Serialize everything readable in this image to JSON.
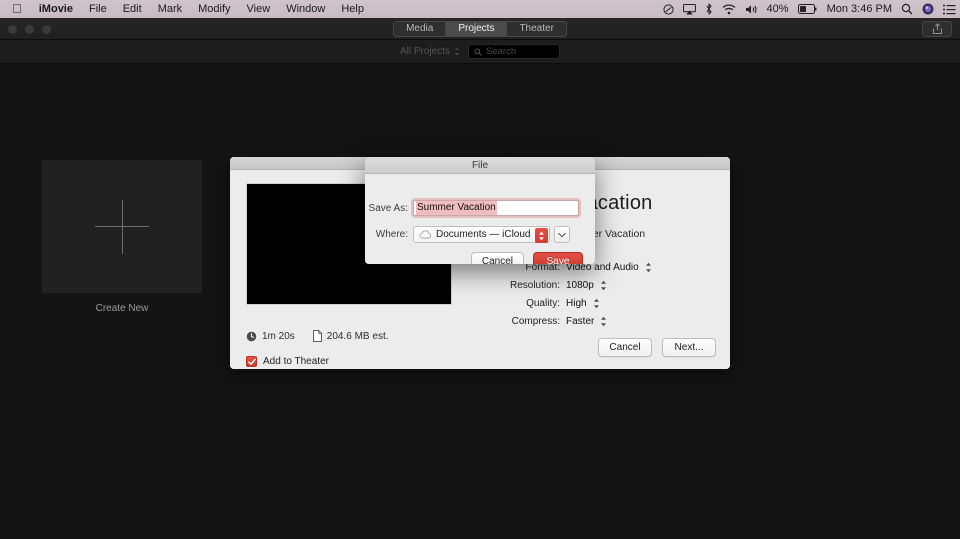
{
  "menubar": {
    "apple_icon": "apple-logo",
    "items": [
      {
        "label": "iMovie",
        "bold": true
      },
      {
        "label": "File"
      },
      {
        "label": "Edit"
      },
      {
        "label": "Mark"
      },
      {
        "label": "Modify"
      },
      {
        "label": "View"
      },
      {
        "label": "Window"
      },
      {
        "label": "Help"
      }
    ],
    "status": {
      "battery_percent": "40%",
      "clock": "Mon 3:46 PM",
      "icons": [
        "dnd-icon",
        "airplay-icon",
        "bluetooth-icon",
        "wifi-icon",
        "volume-icon",
        "battery-icon",
        "spotlight-icon",
        "siri-icon",
        "notification-center-icon"
      ]
    }
  },
  "window": {
    "segmented_control": {
      "options": [
        "Media",
        "Projects",
        "Theater"
      ],
      "selected": "Projects"
    },
    "share_icon": "share-icon",
    "browser_bar": {
      "filter_label": "All Projects",
      "filter_chevron": "chevron-updown-icon",
      "search_icon": "search-icon",
      "search_placeholder": "Search",
      "search_value": ""
    },
    "projects": [
      {
        "label": "Create New",
        "icon": "plus-icon"
      }
    ]
  },
  "export_sheet": {
    "title": "Summer Vacation",
    "description": "A movie about Summer Vacation",
    "fields": [
      {
        "label": "Format:",
        "value": "Video and Audio",
        "stepper": "stepper-icon"
      },
      {
        "label": "Resolution:",
        "value": "1080p",
        "stepper": "stepper-icon"
      },
      {
        "label": "Quality:",
        "value": "High",
        "stepper": "stepper-icon"
      },
      {
        "label": "Compress:",
        "value": "Faster",
        "stepper": "stepper-icon"
      }
    ],
    "duration": "1m 20s",
    "duration_icon": "clock-icon",
    "filesize": "204.6 MB est.",
    "filesize_icon": "file-icon",
    "add_to_theater": {
      "label": "Add to Theater",
      "checked": true
    },
    "buttons": {
      "cancel": "Cancel",
      "next": "Next..."
    }
  },
  "save_dialog": {
    "title": "File",
    "save_as_label": "Save As:",
    "save_as_value": "Summer Vacation",
    "where_label": "Where:",
    "where_value": "Documents — iCloud",
    "where_icon": "icloud-icon",
    "expand_icon": "chevron-down-icon",
    "buttons": {
      "cancel": "Cancel",
      "save": "Save"
    }
  },
  "colors": {
    "accent_red": "#cf3a30",
    "desktop": "#141414",
    "menubar": "#cfc4c9"
  }
}
